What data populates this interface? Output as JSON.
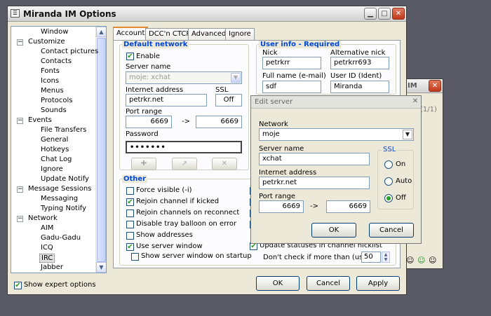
{
  "main_window": {
    "title": "Miranda IM Options",
    "show_expert_label": "Show expert options",
    "buttons": {
      "ok": "OK",
      "cancel": "Cancel",
      "apply": "Apply"
    }
  },
  "tree": {
    "items": [
      {
        "label": "Window",
        "level": 2
      },
      {
        "label": "Customize",
        "level": 1,
        "expander": "−"
      },
      {
        "label": "Contact pictures",
        "level": 2
      },
      {
        "label": "Contacts",
        "level": 2
      },
      {
        "label": "Fonts",
        "level": 2
      },
      {
        "label": "Icons",
        "level": 2
      },
      {
        "label": "Menus",
        "level": 2
      },
      {
        "label": "Protocols",
        "level": 2
      },
      {
        "label": "Sounds",
        "level": 2
      },
      {
        "label": "Events",
        "level": 1,
        "expander": "−"
      },
      {
        "label": "File Transfers",
        "level": 2
      },
      {
        "label": "General",
        "level": 2
      },
      {
        "label": "Hotkeys",
        "level": 2
      },
      {
        "label": "Chat Log",
        "level": 2
      },
      {
        "label": "Ignore",
        "level": 2
      },
      {
        "label": "Update Notify",
        "level": 2
      },
      {
        "label": "Message Sessions",
        "level": 1,
        "expander": "−"
      },
      {
        "label": "Messaging",
        "level": 2
      },
      {
        "label": "Typing Notify",
        "level": 2
      },
      {
        "label": "Network",
        "level": 1,
        "expander": "−"
      },
      {
        "label": "AIM",
        "level": 2
      },
      {
        "label": "Gadu-Gadu",
        "level": 2
      },
      {
        "label": "ICQ",
        "level": 2
      },
      {
        "label": "IRC",
        "level": 2,
        "selected": true
      },
      {
        "label": "Jabber",
        "level": 2
      }
    ]
  },
  "tabs": [
    "Account",
    "DCC'n CTCP",
    "Advanced",
    "Ignore"
  ],
  "default_network": {
    "title": "Default network",
    "enable_label": "Enable",
    "server_name_label": "Server name",
    "server_name_value": "moje: xchat",
    "internet_address_label": "Internet address",
    "internet_address_value": "petrkr.net",
    "ssl_label": "SSL",
    "ssl_value": "Off",
    "port_range_label": "Port range",
    "port_from": "6669",
    "port_arrow": "->",
    "port_to": "6669",
    "password_label": "Password",
    "password_value": "•••••••"
  },
  "user_info": {
    "title": "User info - Required",
    "nick_label": "Nick",
    "nick_value": "petrkrr",
    "alt_nick_label": "Alternative nick",
    "alt_nick_value": "petrkrr693",
    "full_name_label": "Full name (e-mail)",
    "full_name_value": "sdf",
    "user_id_label": "User ID (Ident)",
    "user_id_value": "Miranda"
  },
  "other": {
    "title": "Other",
    "options": [
      {
        "label": "Force visible (-i)",
        "checked": false
      },
      {
        "label": "Rejoin channel if kicked",
        "checked": true
      },
      {
        "label": "Rejoin channels on reconnect",
        "checked": false
      },
      {
        "label": "Disable tray balloon on error",
        "checked": false
      },
      {
        "label": "Show addresses",
        "checked": false
      },
      {
        "label": "Use server window",
        "checked": true
      },
      {
        "label": "Show server window on startup",
        "checked": false
      }
    ],
    "right_partial_text": "Update statuses in channel nicklist",
    "dont_check_label": "Don't check if more than (users):",
    "dont_check_value": "50"
  },
  "edit_server": {
    "title": "Edit server",
    "network_label": "Network",
    "network_value": "moje",
    "server_name_label": "Server name",
    "server_name_value": "xchat",
    "internet_address_label": "Internet address",
    "internet_address_value": "petrkr.net",
    "port_range_label": "Port range",
    "port_from": "6669",
    "port_arrow": "->",
    "port_to": "6669",
    "ssl_label": "SSL",
    "ssl_options": [
      {
        "label": "On",
        "selected": false
      },
      {
        "label": "Auto",
        "selected": false
      },
      {
        "label": "Off",
        "selected": true
      }
    ],
    "ok": "OK",
    "cancel": "Cancel"
  },
  "background_window": {
    "title_partial": "IM",
    "counter": "(1/1)"
  }
}
